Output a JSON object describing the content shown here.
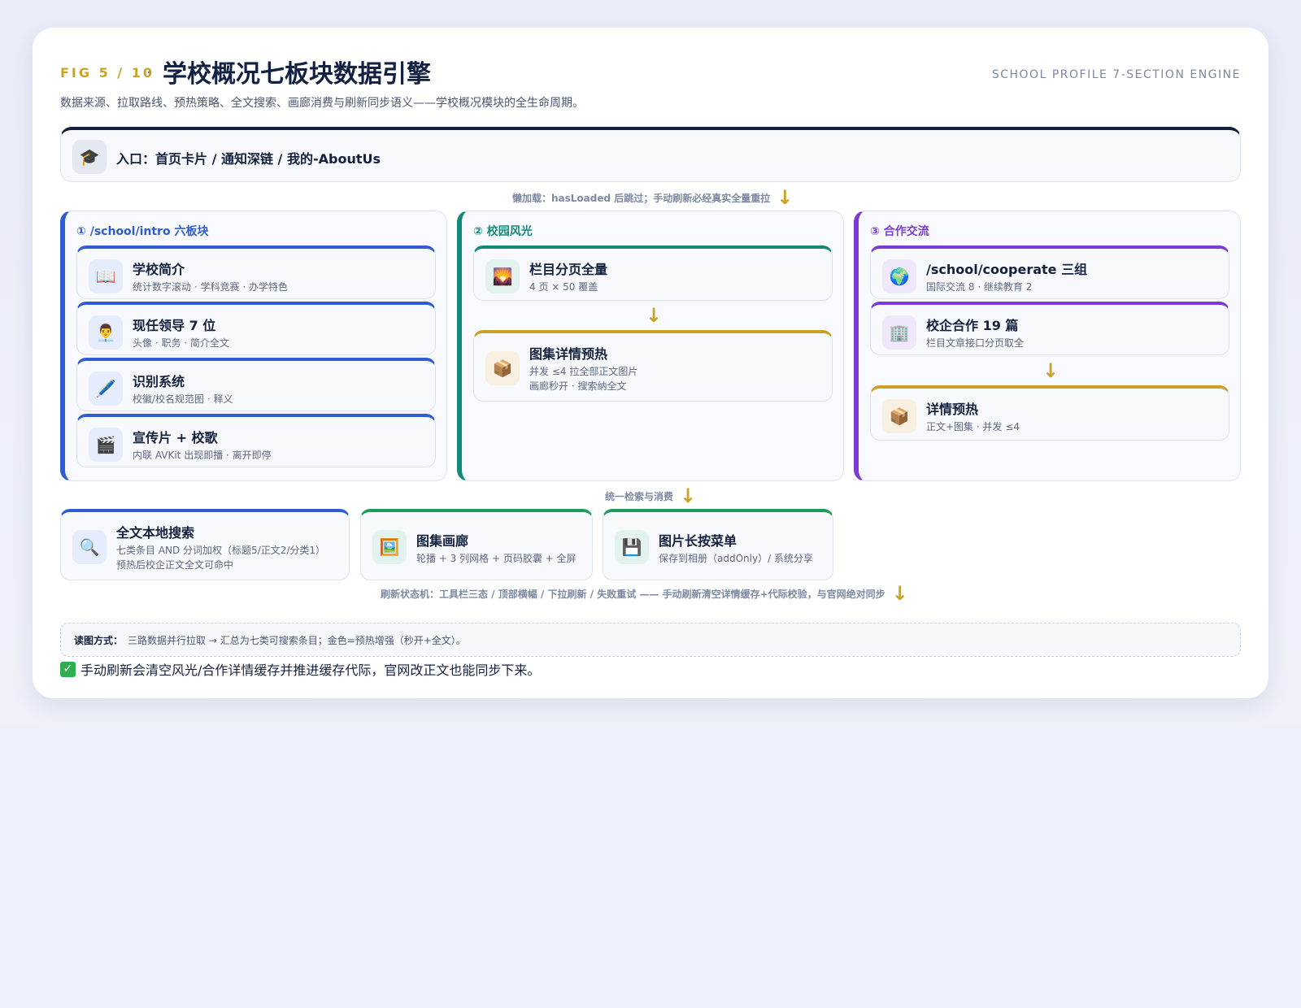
{
  "header": {
    "fig_label": "FIG 5 / 10",
    "separator": "·",
    "title": "学校概况七板块数据引擎",
    "engine_label": "SCHOOL PROFILE 7-SECTION ENGINE",
    "subtitle": "数据来源、拉取路线、预热策略、全文搜索、画廊消费与刷新同步语义——学校概况模块的全生命周期。"
  },
  "entry": {
    "icon": "graduation-cap-icon",
    "label": "入口：首页卡片 / 通知深链 / 我的-AboutUs"
  },
  "connectors": {
    "lazy_load": "懒加载：hasLoaded 后跳过；手动刷新必经真实全量重拉",
    "unified": "统一检索与消费",
    "refresh": "刷新状态机：工具栏三态 / 顶部横幅 / 下拉刷新 / 失败重试 —— 手动刷新清空详情缓存+代际校验，与官网绝对同步"
  },
  "columns": {
    "intro": {
      "title": "① /school/intro 六板块",
      "color": "#2f5bd3",
      "items": [
        {
          "icon": "book-icon",
          "title": "学校简介",
          "desc": "统计数字滚动 · 学科竞赛 · 办学特色"
        },
        {
          "icon": "person-icon",
          "title": "现任领导 7 位",
          "desc": "头像 · 职务 · 简介全文"
        },
        {
          "icon": "pen-icon",
          "title": "识别系统",
          "desc": "校徽/校名规范图 · 释义"
        },
        {
          "icon": "clapper-icon",
          "title": "宣传片 + 校歌",
          "desc": "内联 AVKit 出现即播 · 离开即停"
        }
      ]
    },
    "scenery": {
      "title": "② 校园风光",
      "color": "#138a78",
      "items": [
        {
          "icon": "landscape-icon",
          "title": "栏目分页全量",
          "desc": "4 页 × 50 覆盖"
        },
        {
          "icon": "box-icon",
          "title": "图集详情预热",
          "desc": "并发 ≤4 拉全部正文图片",
          "desc2": "画廊秒开 · 搜索纳全文"
        }
      ]
    },
    "cooperate": {
      "title": "③ 合作交流",
      "color": "#7d3bd6",
      "items": [
        {
          "icon": "globe-icon",
          "title": "/school/cooperate 三组",
          "desc": "国际交流 8 · 继续教育 2"
        },
        {
          "icon": "building-icon",
          "title": "校企合作 19 篇",
          "desc": "栏目文章接口分页取全"
        },
        {
          "icon": "box-icon",
          "title": "详情预热",
          "desc": "正文+图集 · 并发 ≤4"
        }
      ]
    }
  },
  "consumers": [
    {
      "icon": "search-icon",
      "title": "全文本地搜索",
      "desc": "七类条目 AND 分词加权（标题5/正文2/分类1）",
      "desc2": "预热后校企正文全文可命中"
    },
    {
      "icon": "picture-icon",
      "title": "图集画廊",
      "desc": "轮播 + 3 列网格 + 页码胶囊 + 全屏"
    },
    {
      "icon": "floppy-icon",
      "title": "图片长按菜单",
      "desc": "保存到相册（addOnly）/ 系统分享"
    }
  ],
  "note": {
    "label": "读图方式：",
    "text": "三路数据并行拉取 → 汇总为七类可搜索条目；金色=预热增强（秒开+全文）。"
  },
  "check": {
    "icon": "check-icon",
    "text": "手动刷新会清空风光/合作详情缓存并推进缓存代际，官网改正文也能同步下来。"
  },
  "colors": {
    "navy": "#14213d",
    "gold": "#c9a227",
    "blue": "#2f5bd3",
    "teal": "#138a78",
    "purple": "#7d3bd6",
    "green": "#1f9b5a"
  }
}
